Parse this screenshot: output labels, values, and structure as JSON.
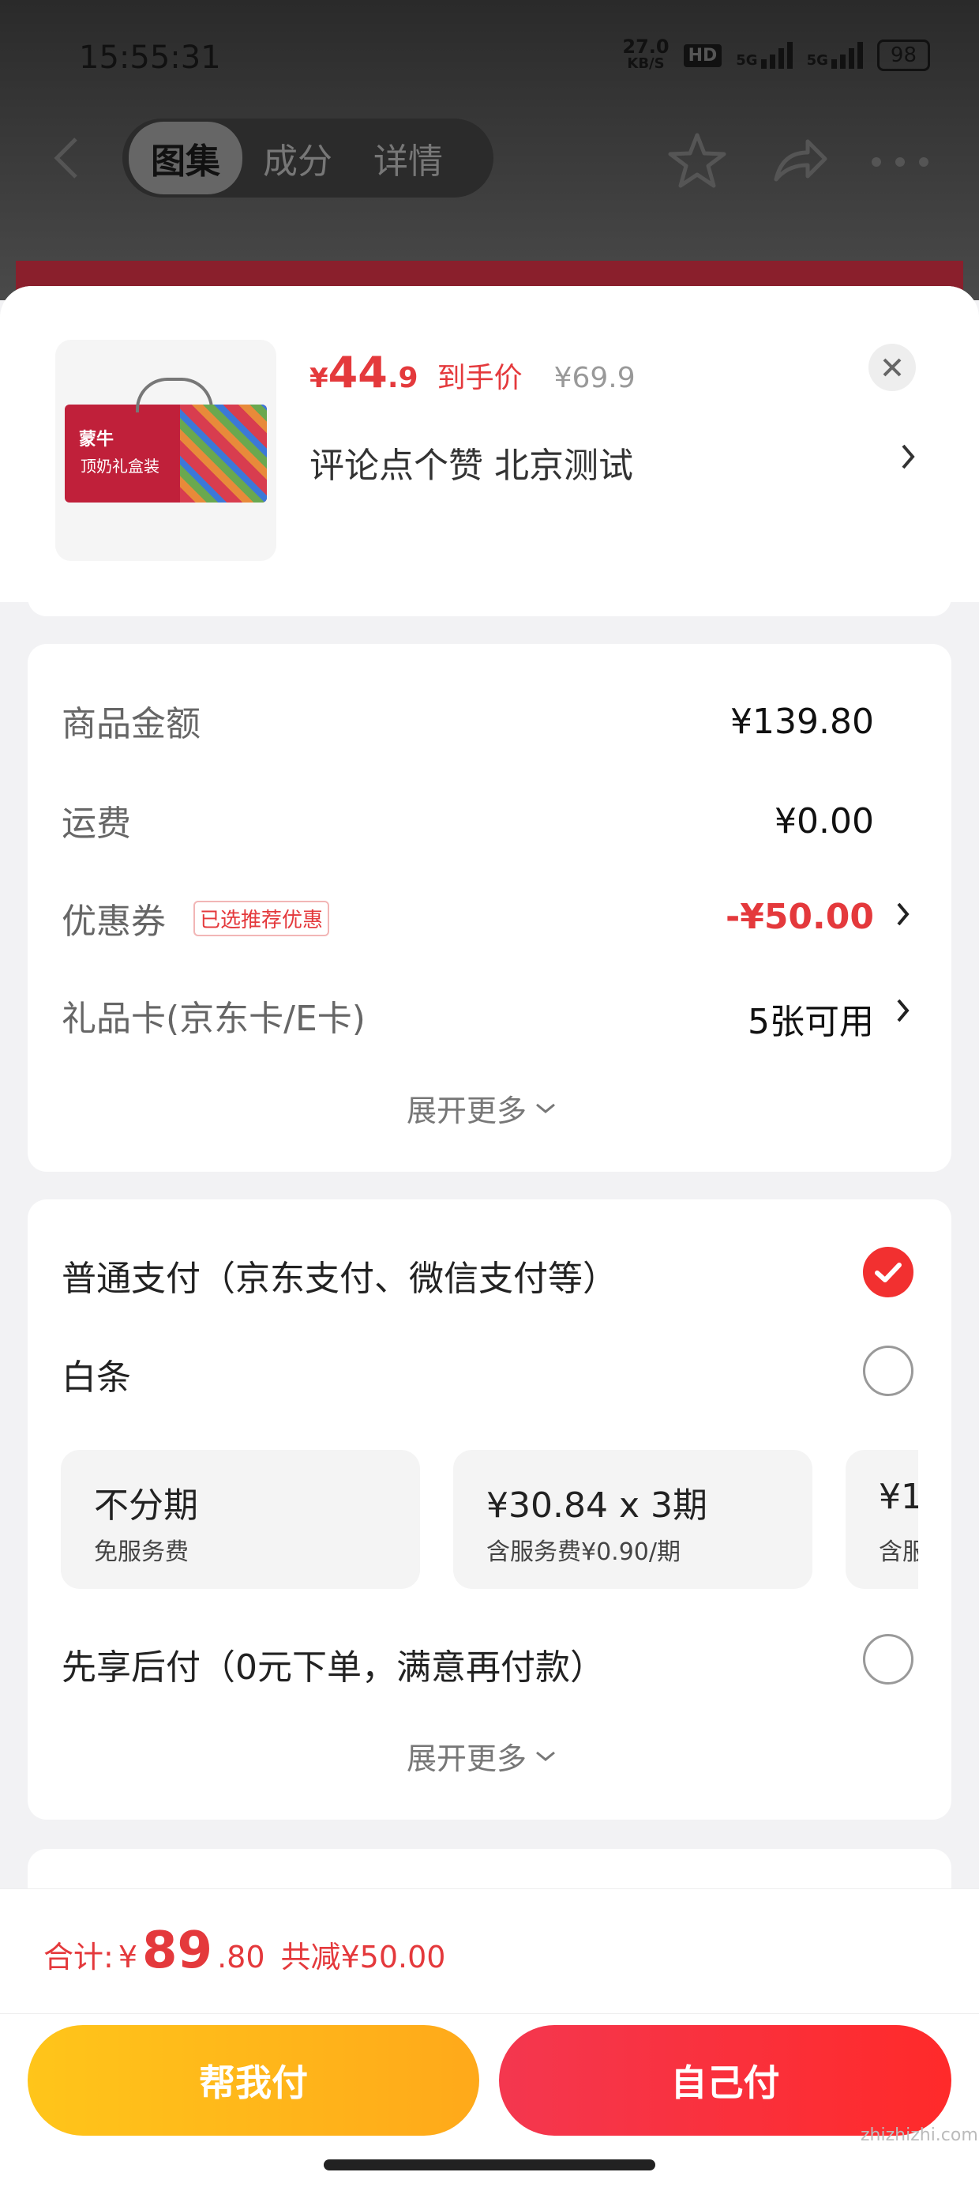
{
  "status_bar": {
    "time": "15:55:31",
    "net_speed": "27.0",
    "net_unit": "KB/S",
    "hd": "HD",
    "sig1": "5G",
    "sig2": "5G",
    "battery": "98"
  },
  "top_nav": {
    "tabs": [
      "图集",
      "成分",
      "详情"
    ]
  },
  "product": {
    "price_symbol": "¥",
    "price_int": "44",
    "price_dec": ".9",
    "price_tag": "到手价",
    "original_price": "¥69.9",
    "spec": "评论点个赞  北京测试",
    "thumb_brand": "蒙牛",
    "thumb_box_text": "顶奶礼盒装"
  },
  "summary": {
    "rows": [
      {
        "label": "商品金额",
        "value": "¥139.80"
      },
      {
        "label": "运费",
        "value": "¥0.00"
      },
      {
        "label": "优惠券",
        "badge": "已选推荐优惠",
        "value": "-¥50.00"
      },
      {
        "label": "礼品卡(京东卡/E卡)",
        "value": "5张可用"
      }
    ],
    "expand": "展开更多"
  },
  "payment": {
    "options": [
      {
        "label": "普通支付（京东支付、微信支付等）",
        "checked": true
      },
      {
        "label": "白条",
        "checked": false
      },
      {
        "label": "先享后付（0元下单，满意再付款）",
        "checked": false
      }
    ],
    "plans": [
      {
        "title": "不分期",
        "sub": "免服务费"
      },
      {
        "title": "¥30.84 x 3期",
        "sub": "含服务费¥0.90/期"
      },
      {
        "title": "¥1",
        "sub": "含服"
      }
    ],
    "expand": "展开更多"
  },
  "bottom": {
    "total_label": "合计:",
    "total_symbol": "¥",
    "total_int": "89",
    "total_dec": ".80",
    "total_discount": "共减¥50.00",
    "help_pay": "帮我付",
    "self_pay": "自己付"
  },
  "watermark": "zhizhizhi.com",
  "colors": {
    "accent_red": "#e4393c",
    "help_pay_yellow": "#ffb81a",
    "self_pay_red": "#f4374f"
  }
}
